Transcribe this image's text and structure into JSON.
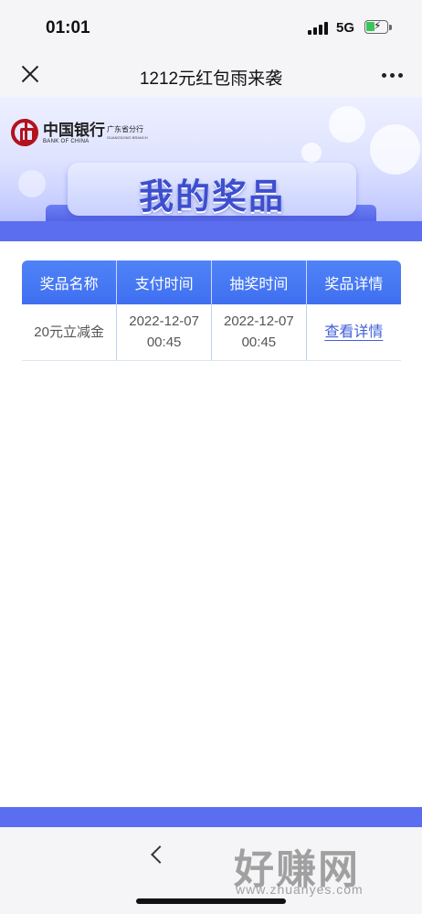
{
  "status": {
    "time": "01:01",
    "network": "5G",
    "battery_color": "#39c659"
  },
  "nav": {
    "title": "1212元红包雨来袭",
    "close_icon": "close-icon",
    "more_icon": "more-icon"
  },
  "banner": {
    "bank_name_cn": "中国银行",
    "bank_name_en": "BANK OF CHINA",
    "branch_cn": "广东省分行",
    "branch_en": "GUANGDONG BRANCH",
    "heading": "我的奖品",
    "accent": "#5b6ef0"
  },
  "table": {
    "headers": [
      "奖品名称",
      "支付时间",
      "抽奖时间",
      "奖品详情"
    ],
    "rows": [
      {
        "name": "20元立减金",
        "pay_date": "2022-12-07",
        "pay_time": "00:45",
        "draw_date": "2022-12-07",
        "draw_time": "00:45",
        "detail": "查看详情"
      }
    ],
    "header_color": "#4f83f7"
  },
  "bottom": {
    "back_icon": "chevron-left-icon",
    "watermark": "好赚网",
    "watermark_url": "www.zhuanyes.com"
  }
}
